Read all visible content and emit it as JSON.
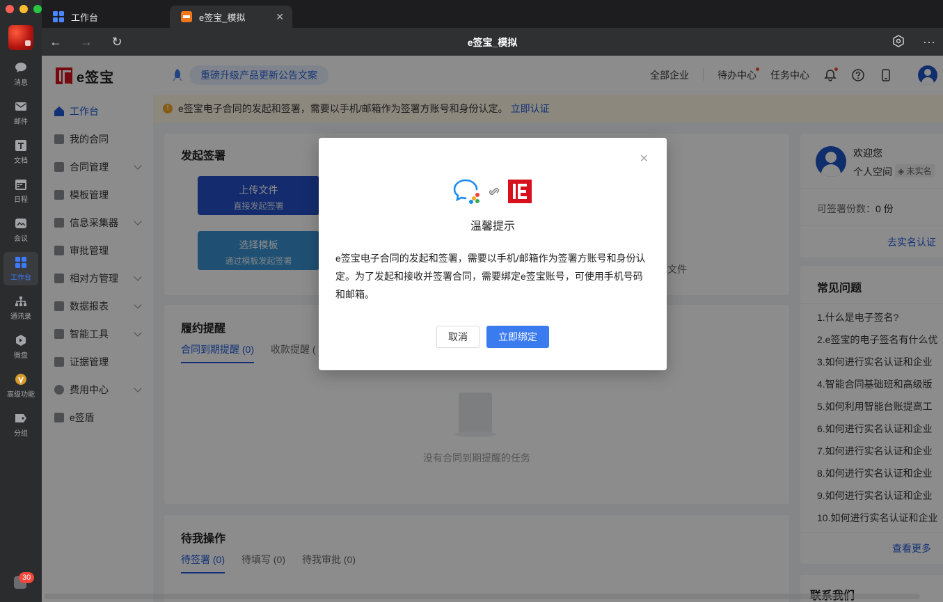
{
  "dock": {
    "items": [
      {
        "label": "消息",
        "icon": "chat-icon"
      },
      {
        "label": "邮件",
        "icon": "mail-icon"
      },
      {
        "label": "文档",
        "icon": "doc-icon"
      },
      {
        "label": "日程",
        "icon": "calendar-icon"
      },
      {
        "label": "会议",
        "icon": "video-icon"
      },
      {
        "label": "工作台",
        "icon": "grid-icon"
      },
      {
        "label": "通讯录",
        "icon": "contacts-icon"
      },
      {
        "label": "微盘",
        "icon": "drive-icon"
      },
      {
        "label": "高级功能",
        "icon": "star-icon"
      },
      {
        "label": "分组",
        "icon": "tag-icon"
      }
    ],
    "badge": "30"
  },
  "tabs": [
    {
      "label": "工作台"
    },
    {
      "label": "e签宝_模拟"
    }
  ],
  "navbar": {
    "title": "e签宝_模拟"
  },
  "app": {
    "logo_text": "e签宝",
    "menu": [
      {
        "label": "工作台"
      },
      {
        "label": "我的合同"
      },
      {
        "label": "合同管理"
      },
      {
        "label": "模板管理"
      },
      {
        "label": "信息采集器"
      },
      {
        "label": "审批管理"
      },
      {
        "label": "相对方管理"
      },
      {
        "label": "数据报表"
      },
      {
        "label": "智能工具"
      },
      {
        "label": "证据管理"
      },
      {
        "label": "费用中心"
      },
      {
        "label": "e签盾"
      }
    ],
    "topbar": {
      "promo": "重磅升级产品更新公告文案",
      "all_companies": "全部企业",
      "todo_center": "待办中心",
      "task_center": "任务中心"
    },
    "notice": {
      "text": "e签宝电子合同的发起和签署，需要以手机/邮箱作为签署方账号和身份认定。",
      "link": "立即认证"
    },
    "start_sign": {
      "title": "发起签署",
      "upload_main": "上传文件",
      "upload_sub": "直接发起签署",
      "template_main": "选择模板",
      "template_sub": "通过模板发起签署",
      "partial_text": "文件"
    },
    "reminder": {
      "title": "履约提醒",
      "tab1": "合同到期提醒 (0)",
      "tab2": "收款提醒 (",
      "empty": "没有合同到期提醒的任务"
    },
    "pending": {
      "title": "待我操作",
      "tab1": "待签署 (0)",
      "tab2": "待填写 (0)",
      "tab3": "待我审批 (0)"
    },
    "profile": {
      "welcome": "欢迎您",
      "space": "个人空间",
      "unverified": "未实名",
      "quota_label": "可签署份数：",
      "quota_value": "0 份",
      "verify_link": "去实名认证"
    },
    "faq": {
      "title": "常见问题",
      "items": [
        "1.什么是电子签名?",
        "2.e签宝的电子签名有什么优",
        "3.如何进行实名认证和企业",
        "4.智能合同基础班和高级版",
        "5.如何利用智能台账提高工",
        "6.如何进行实名认证和企业",
        "7.如何进行实名认证和企业",
        "8.如何进行实名认证和企业",
        "9.如何进行实名认证和企业",
        "10.如何进行实名认证和企业"
      ],
      "more": "查看更多"
    },
    "contact_title": "联系我们"
  },
  "modal": {
    "title": "温馨提示",
    "body": "e签宝电子合同的发起和签署，需要以手机/邮箱作为签署方账号和身份认定。为了发起和接收并签署合同，需要绑定e签宝账号，可使用手机号码和邮箱。",
    "cancel": "取消",
    "confirm": "立即绑定"
  },
  "colors": {
    "accent": "#1f5ad8",
    "brand_red": "#d7101c",
    "button_blue": "#3a7bf0"
  }
}
